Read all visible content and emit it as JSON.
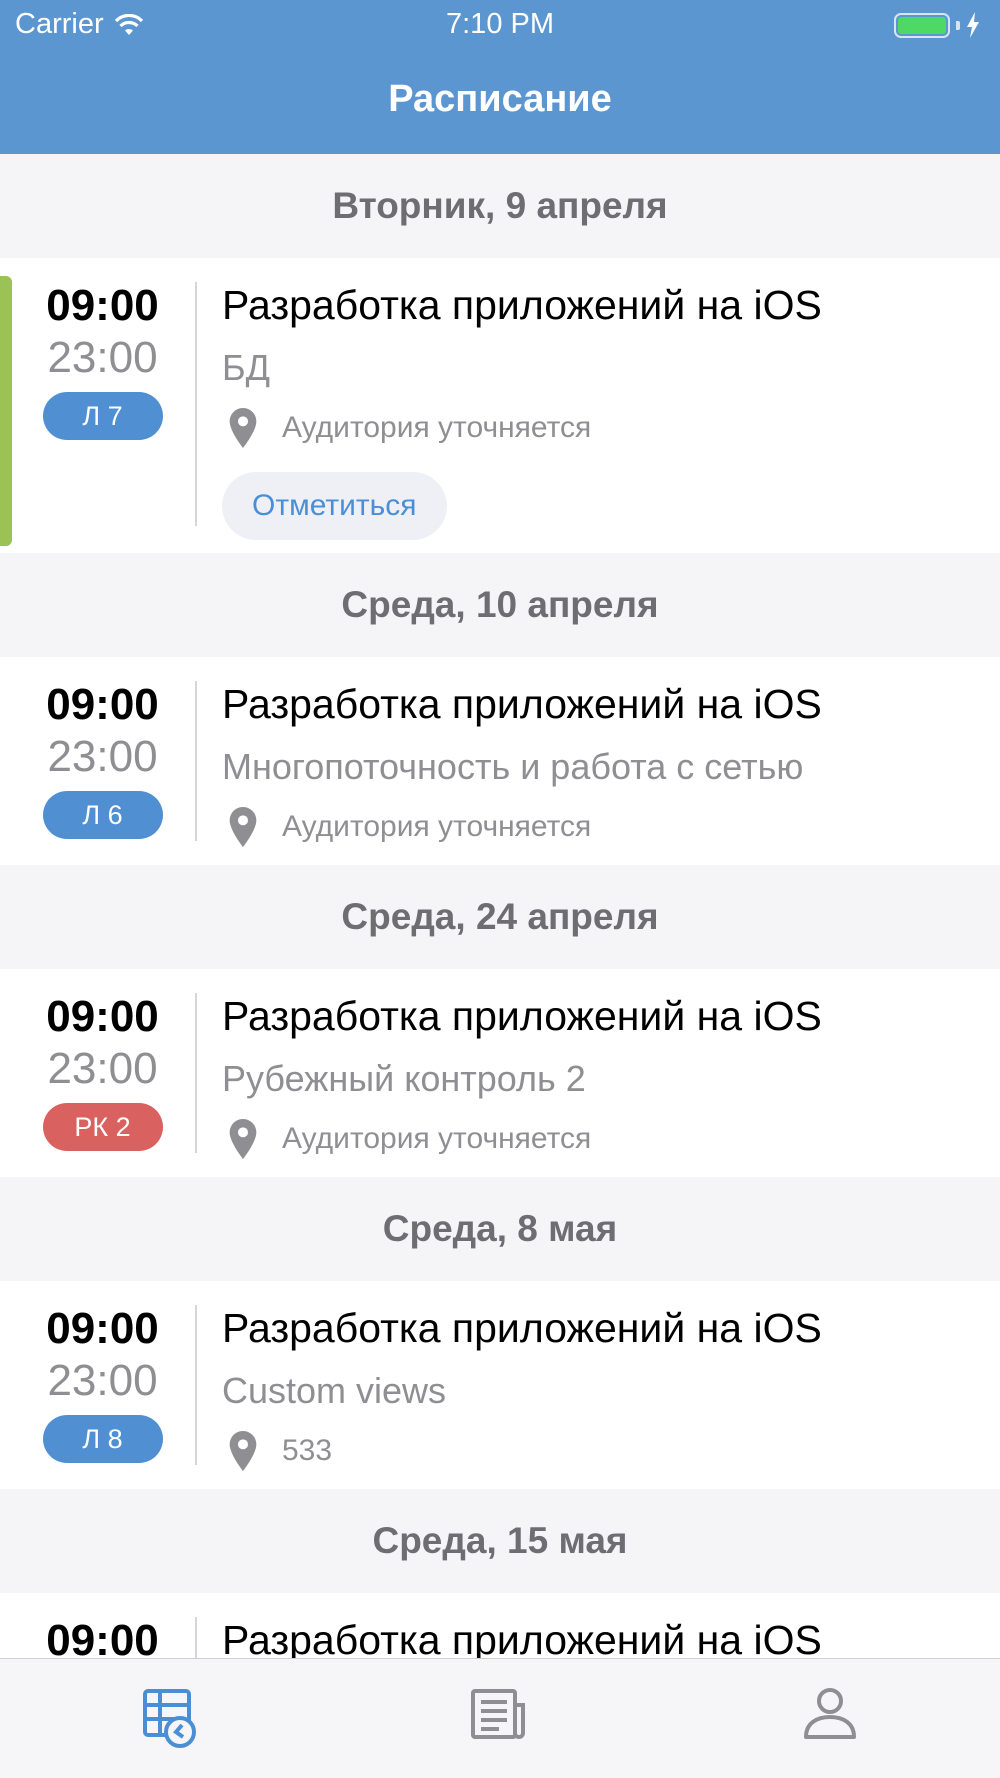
{
  "status_bar": {
    "carrier": "Carrier",
    "time": "7:10 PM"
  },
  "nav": {
    "title": "Расписание"
  },
  "colors": {
    "accent": "#5b96d0",
    "lecture_badge": "#4f8fd2",
    "control_badge": "#d9615f",
    "current_marker": "#9bc255"
  },
  "days": [
    {
      "header": "Вторник, 9 апреля",
      "start": "09:00",
      "end": "23:00",
      "badge": "Л 7",
      "subject": "Разработка приложений на iOS",
      "topic": "БД",
      "room": "Аудитория уточняется",
      "action": "Отметиться"
    },
    {
      "header": "Среда, 10 апреля",
      "start": "09:00",
      "end": "23:00",
      "badge": "Л 6",
      "subject": "Разработка приложений на iOS",
      "topic": "Многопоточность и работа с сетью",
      "room": "Аудитория уточняется"
    },
    {
      "header": "Среда, 24 апреля",
      "start": "09:00",
      "end": "23:00",
      "badge": "РК 2",
      "subject": "Разработка приложений на iOS",
      "topic": "Рубежный контроль 2",
      "room": "Аудитория уточняется"
    },
    {
      "header": "Среда, 8 мая",
      "start": "09:00",
      "end": "23:00",
      "badge": "Л 8",
      "subject": "Разработка приложений на iOS",
      "topic": "Custom views",
      "room": "533"
    },
    {
      "header": "Среда, 15 мая",
      "start": "09:00",
      "subject": "Разработка приложений на iOS"
    }
  ],
  "tabbar": {
    "items": [
      {
        "icon": "schedule-icon",
        "active": true
      },
      {
        "icon": "news-icon",
        "active": false
      },
      {
        "icon": "profile-icon",
        "active": false
      }
    ]
  }
}
